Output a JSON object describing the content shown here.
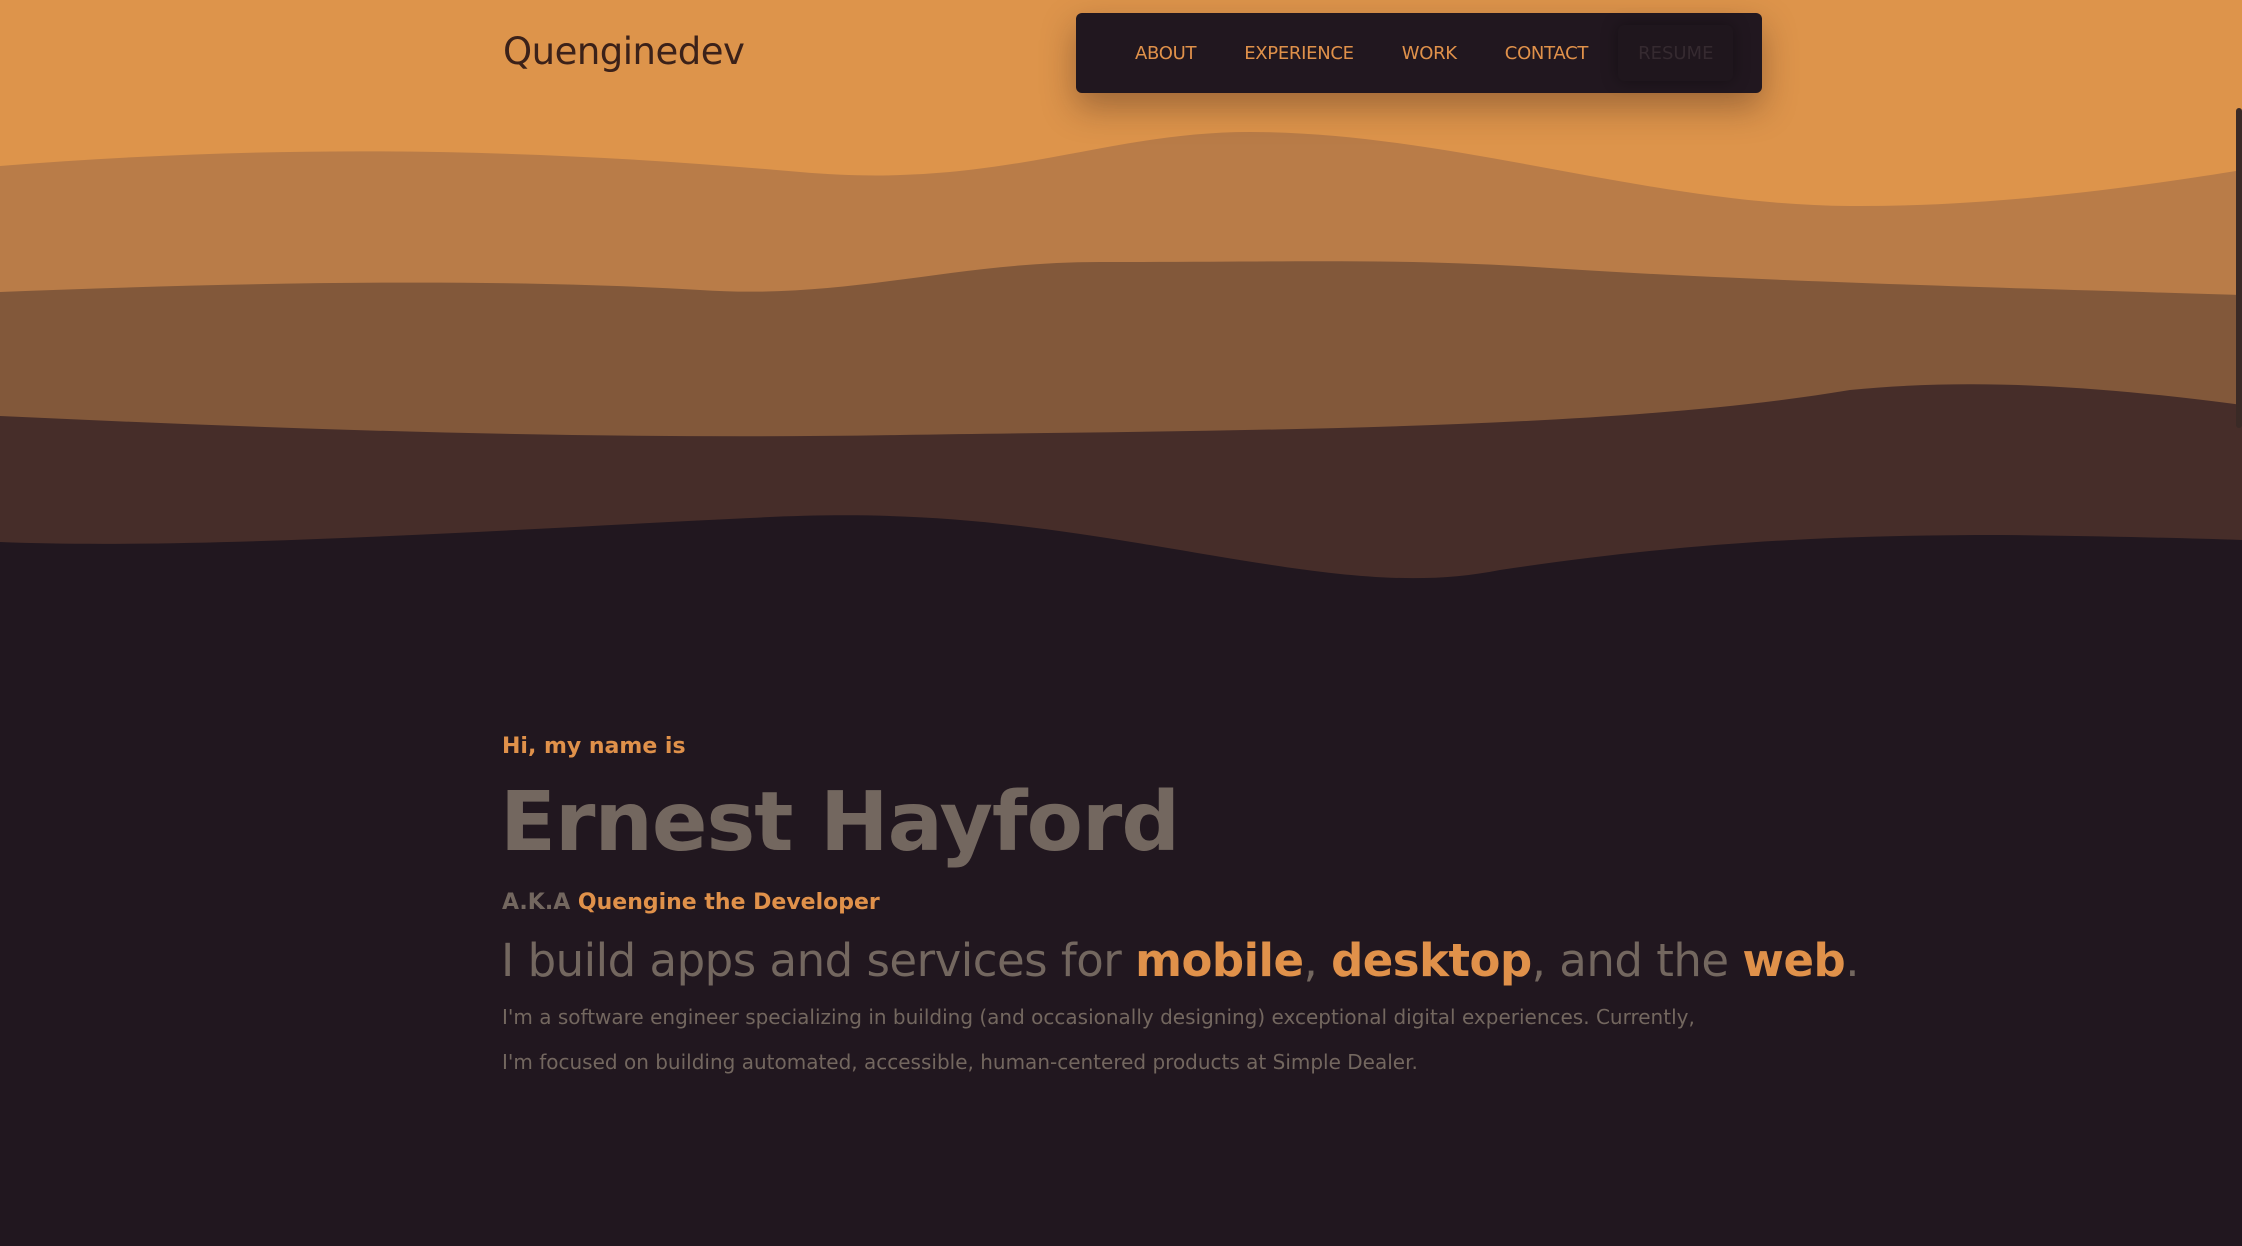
{
  "site": {
    "logo": "Quenginedev"
  },
  "nav": {
    "items": [
      "ABOUT",
      "EXPERIENCE",
      "WORK",
      "CONTACT"
    ],
    "resume_label": "RESUME"
  },
  "hero": {
    "greeting": "Hi, my name is",
    "name": "Ernest Hayford",
    "aka_label": "A.K.A",
    "aka_name": "Quengine the Developer",
    "tagline": {
      "prefix": "I build apps and services for ",
      "mobile": "mobile",
      "sep1": ", ",
      "desktop": "desktop",
      "sep2": ", and the ",
      "web": "web",
      "suffix": "."
    },
    "bio_line1": "I'm a software engineer specializing in building (and occasionally designing) exceptional digital experiences. Currently,",
    "bio_line2": "I'm focused on building automated, accessible, human-centered products at Simple Dealer."
  },
  "colors": {
    "sand_top": "#dd944b",
    "wave_1": "#b97c48",
    "wave_2": "#82583a",
    "wave_3": "#462d29",
    "background": "#21171f",
    "accent": "#e0914a",
    "muted_text": "#73675f"
  }
}
